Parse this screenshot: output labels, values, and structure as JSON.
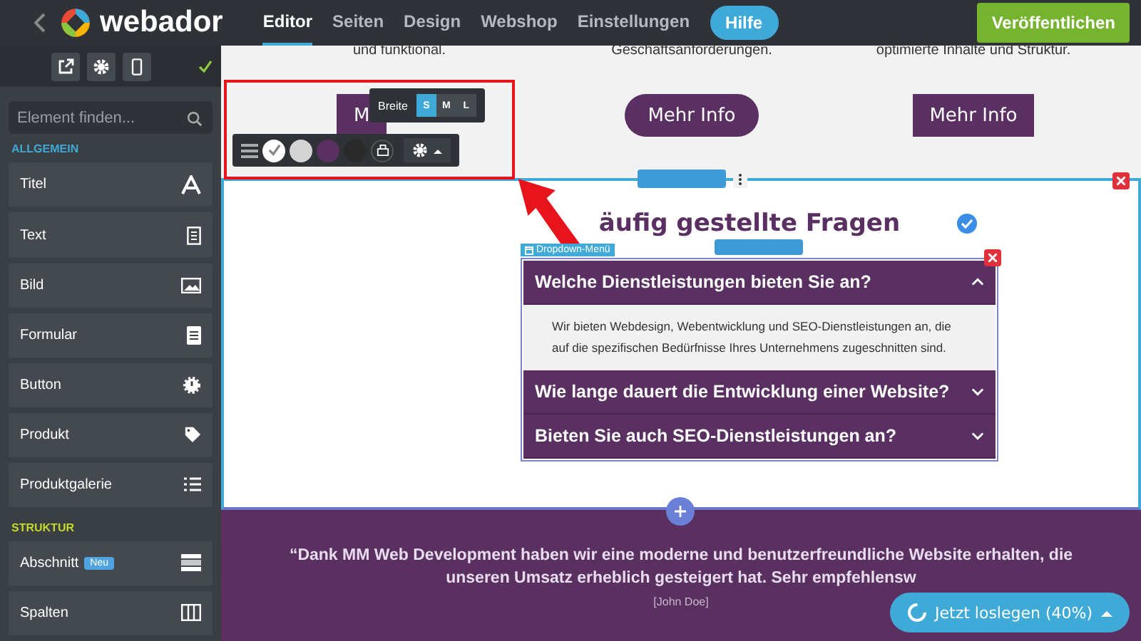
{
  "topbar": {
    "logo": "webador",
    "nav": [
      {
        "label": "Editor",
        "selected": true
      },
      {
        "label": "Seiten",
        "selected": false
      },
      {
        "label": "Design",
        "selected": false
      },
      {
        "label": "Webshop",
        "selected": false
      },
      {
        "label": "Einstellungen",
        "selected": false
      }
    ],
    "help": "Hilfe",
    "publish": "Veröffentlichen"
  },
  "sidebar": {
    "search": {
      "placeholder": "Element finden..."
    },
    "groups": [
      {
        "title": "ALLGEMEIN",
        "color": "#3fa9d8",
        "items": [
          {
            "label": "Titel"
          },
          {
            "label": "Text"
          },
          {
            "label": "Bild"
          },
          {
            "label": "Formular"
          },
          {
            "label": "Button"
          },
          {
            "label": "Produkt"
          },
          {
            "label": "Produktgalerie"
          }
        ]
      },
      {
        "title": "STRUKTUR",
        "color": "#c3d82a",
        "items": [
          {
            "label": "Abschnitt",
            "badge": "Neu"
          },
          {
            "label": "Spalten"
          }
        ]
      }
    ]
  },
  "top_section": {
    "texts": [
      "und funktional.",
      "Geschäftsanforderungen.",
      "optimierte Inhalte und Struktur."
    ],
    "buttons": [
      {
        "label": "M",
        "kind": "square"
      },
      {
        "label": "Mehr Info",
        "kind": "pill"
      },
      {
        "label": "Mehr Info",
        "kind": "square"
      }
    ]
  },
  "element_toolbar": {
    "width_label": "Breite",
    "widths": [
      {
        "label": "S",
        "selected": true
      },
      {
        "label": "M",
        "selected": false
      },
      {
        "label": "L",
        "selected": false
      }
    ],
    "swatches": [
      {
        "color": "#ffffff",
        "selected": true
      },
      {
        "color": "#d4d4d4",
        "selected": false
      },
      {
        "color": "#5a2f62",
        "selected": false
      },
      {
        "color": "#2a2a2a",
        "selected": false
      }
    ]
  },
  "faq": {
    "title": "äufig gestellte Fragen",
    "widget_label": "Dropdown-Menü",
    "items": [
      {
        "question": "Welche Dienstleistungen bieten Sie an?",
        "expanded": true,
        "answer": "Wir bieten Webdesign, Webentwicklung und SEO-Dienstleistungen an, die auf die spezifischen Bedürfnisse Ihres Unternehmens zugeschnitten sind."
      },
      {
        "question": "Wie lange dauert die Entwicklung einer Website?",
        "expanded": false
      },
      {
        "question": "Bieten Sie auch SEO-Dienstleistungen an?",
        "expanded": false
      }
    ]
  },
  "testimonial": {
    "quote": "“Dank MM Web Development haben wir eine moderne und benutzerfreundliche Website erhalten, die unseren Umsatz erheblich gesteigert hat. Sehr empfehlensw",
    "author": "[John Doe]"
  },
  "cta": {
    "label": "Jetzt loslegen (40%)"
  }
}
